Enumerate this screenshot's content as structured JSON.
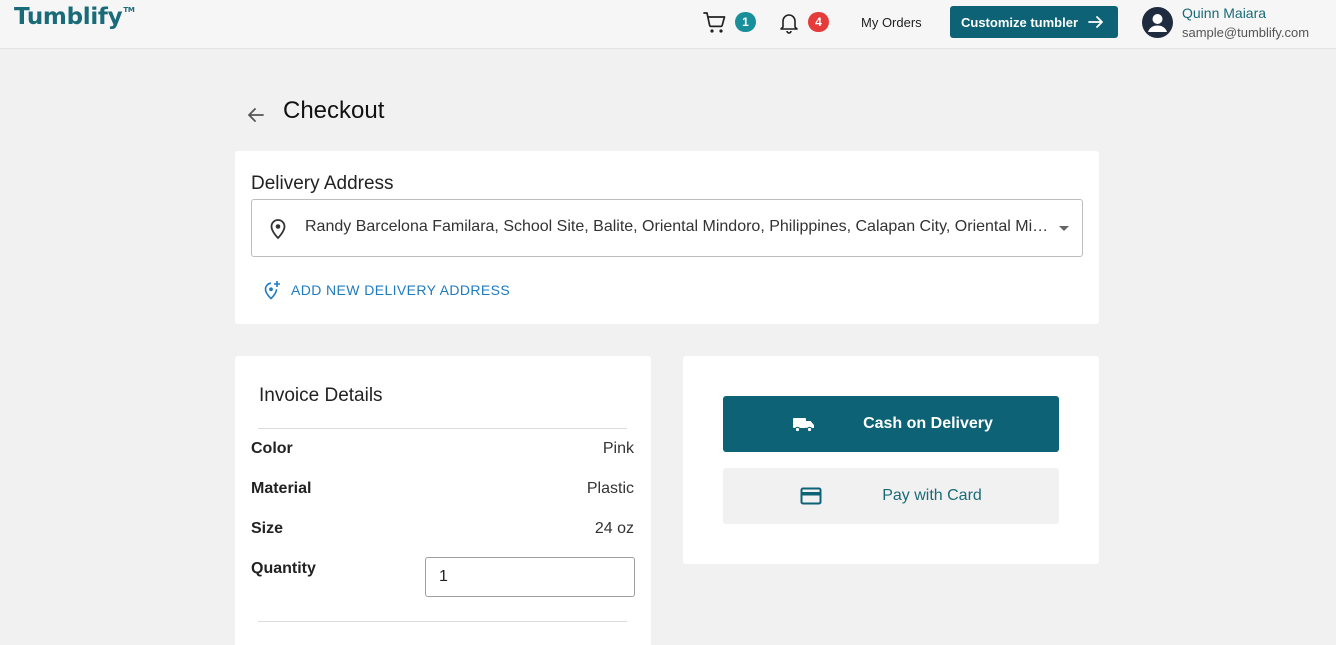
{
  "colors": {
    "brand": "#1a6b78",
    "primary_button": "#0d6275",
    "cart_badge": "#1a8f9c",
    "notification_badge": "#e63b3b",
    "link": "#1f7bc0",
    "user_name": "#1a6b78",
    "pay_card_text": "#1a6b78"
  },
  "header": {
    "logo": "Tumblify",
    "logo_tm": "TM",
    "cart_count": "1",
    "notification_count": "4",
    "my_orders": "My Orders",
    "customize_label": "Customize tumbler",
    "user_name": "Quinn Maiara",
    "user_email": "sample@tumblify.com",
    "icons": {
      "cart": "shopping-cart-icon",
      "bell": "bell-icon",
      "arrow": "arrow-right-icon",
      "avatar": "account-circle-icon"
    }
  },
  "page": {
    "title": "Checkout",
    "back_icon": "arrow-left-icon"
  },
  "delivery": {
    "heading": "Delivery Address",
    "selected_address": "Randy Barcelona Familara, School Site, Balite, Oriental Mindoro, Philippines, Calapan City, Oriental Mindoro",
    "add_new_label": "ADD NEW DELIVERY ADDRESS",
    "icons": {
      "pin": "location-pin-icon",
      "add": "add-location-icon",
      "caret": "caret-down-icon"
    }
  },
  "invoice": {
    "heading": "Invoice Details",
    "rows": [
      {
        "label": "Color",
        "value": "Pink"
      },
      {
        "label": "Material",
        "value": "Plastic"
      },
      {
        "label": "Size",
        "value": "24 oz"
      }
    ],
    "quantity_label": "Quantity",
    "quantity_value": "1"
  },
  "payment": {
    "cod_label": "Cash on Delivery",
    "card_label": "Pay with Card",
    "icons": {
      "cod": "delivery-truck-icon",
      "card": "credit-card-icon"
    }
  }
}
